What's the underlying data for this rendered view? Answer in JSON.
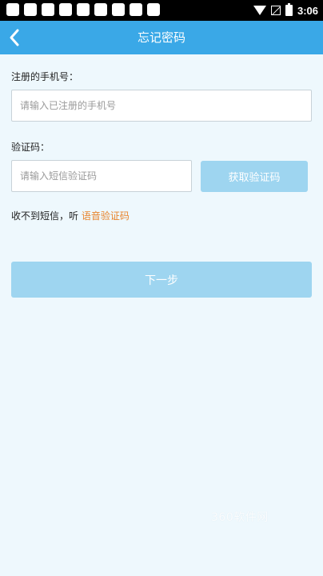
{
  "status_bar": {
    "time": "3:06"
  },
  "header": {
    "title": "忘记密码"
  },
  "form": {
    "phone_label": "注册的手机号：",
    "phone_placeholder": "请输入已注册的手机号",
    "code_label": "验证码：",
    "code_placeholder": "请输入短信验证码",
    "get_code_label": "获取验证码",
    "hint_prefix": "收不到短信，听 ",
    "voice_code_link": "语音验证码",
    "next_label": "下一步"
  },
  "watermark": "360软件网",
  "colors": {
    "header": "#3aa8e7",
    "button_disabled": "#9ed5f0",
    "link": "#e8842c",
    "background": "#eef8fd"
  }
}
